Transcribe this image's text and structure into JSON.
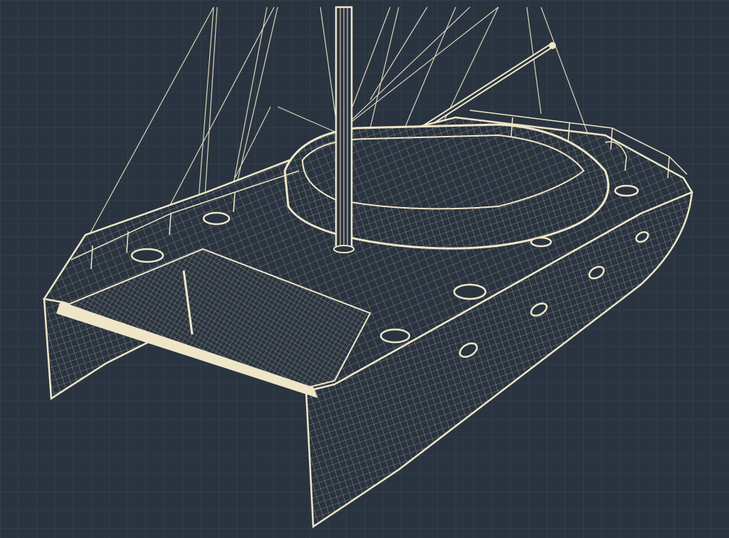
{
  "colors": {
    "background": "#2a3440",
    "grid_fine": "#3a4652",
    "grid_major": "#465462",
    "linework": "#efe6c8",
    "linework_dim": "#d8cfb2"
  },
  "drawing": {
    "subject": "catamaran-wireframe",
    "style": "blueprint-grid"
  }
}
